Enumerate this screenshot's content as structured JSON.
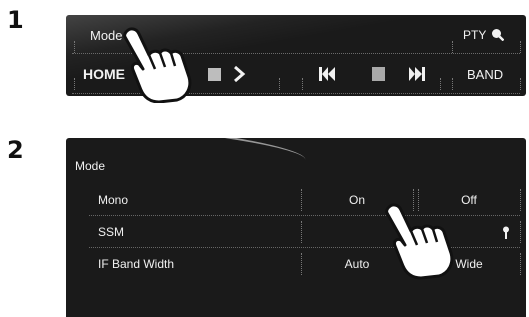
{
  "steps": [
    "1",
    "2"
  ],
  "panel1": {
    "mode_label": "Mode",
    "pty_label": "PTY",
    "home_label": "HOME",
    "band_label": "BAND"
  },
  "panel2": {
    "title": "Mode",
    "rows": [
      {
        "label": "Mono",
        "opt1": "On",
        "opt2": "Off"
      },
      {
        "label": "SSM",
        "opt1": "",
        "opt2": ""
      },
      {
        "label": "IF Band Width",
        "opt1": "Auto",
        "opt2": "Wide"
      }
    ]
  }
}
